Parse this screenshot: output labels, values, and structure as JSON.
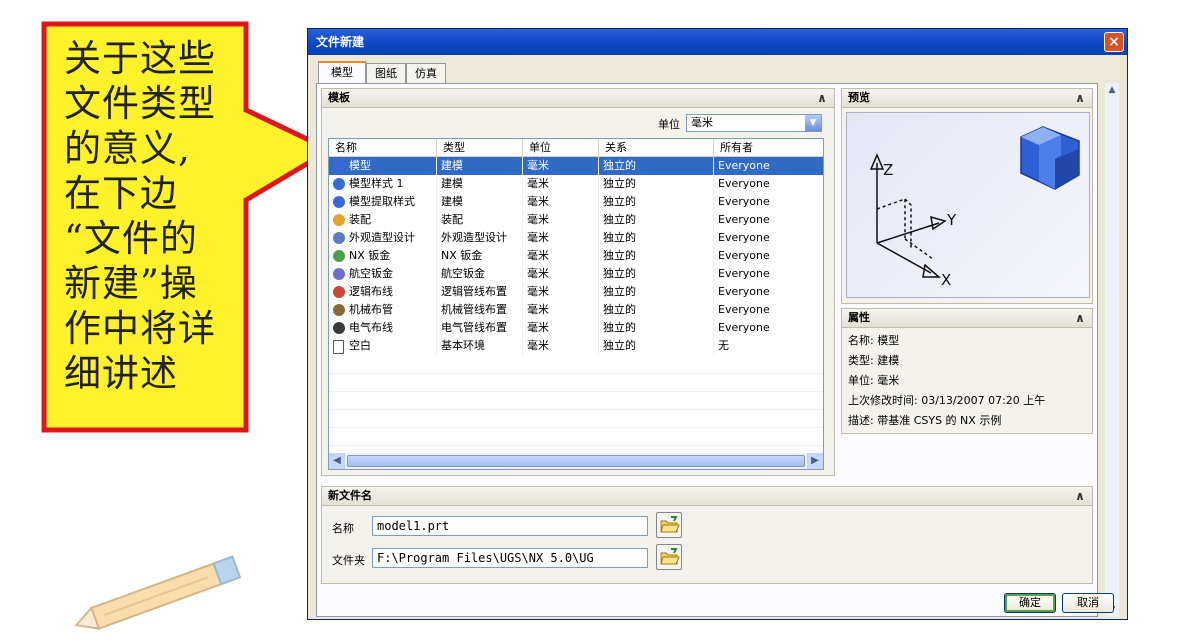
{
  "callout": {
    "lines": [
      "关于这些",
      "文件类型",
      "的意义,",
      "在下边",
      "“文件的",
      "新建”操",
      "作中将详",
      "细讲述"
    ]
  },
  "dialog": {
    "title": "文件新建",
    "close_symbol": "×",
    "tabs": [
      {
        "label": "模型"
      },
      {
        "label": "图纸"
      },
      {
        "label": "仿真"
      }
    ],
    "templates_section": {
      "title": "模板",
      "collapse_symbol": "∧",
      "unit_label": "单位",
      "unit_value": "毫米",
      "columns": [
        "名称",
        "类型",
        "单位",
        "关系",
        "所有者"
      ],
      "rows": [
        {
          "name": "模型",
          "type": "建模",
          "unit": "毫米",
          "relation": "独立的",
          "owner": "Everyone",
          "selected": true
        },
        {
          "name": "模型样式 1",
          "type": "建模",
          "unit": "毫米",
          "relation": "独立的",
          "owner": "Everyone",
          "selected": false
        },
        {
          "name": "模型提取样式",
          "type": "建模",
          "unit": "毫米",
          "relation": "独立的",
          "owner": "Everyone",
          "selected": false
        },
        {
          "name": "装配",
          "type": "装配",
          "unit": "毫米",
          "relation": "独立的",
          "owner": "Everyone",
          "selected": false
        },
        {
          "name": "外观造型设计",
          "type": "外观造型设计",
          "unit": "毫米",
          "relation": "独立的",
          "owner": "Everyone",
          "selected": false
        },
        {
          "name": "NX 钣金",
          "type": "NX 钣金",
          "unit": "毫米",
          "relation": "独立的",
          "owner": "Everyone",
          "selected": false
        },
        {
          "name": "航空钣金",
          "type": "航空钣金",
          "unit": "毫米",
          "relation": "独立的",
          "owner": "Everyone",
          "selected": false
        },
        {
          "name": "逻辑布线",
          "type": "逻辑管线布置",
          "unit": "毫米",
          "relation": "独立的",
          "owner": "Everyone",
          "selected": false
        },
        {
          "name": "机械布管",
          "type": "机械管线布置",
          "unit": "毫米",
          "relation": "独立的",
          "owner": "Everyone",
          "selected": false
        },
        {
          "name": "电气布线",
          "type": "电气管线布置",
          "unit": "毫米",
          "relation": "独立的",
          "owner": "Everyone",
          "selected": false
        },
        {
          "name": "空白",
          "type": "基本环境",
          "unit": "毫米",
          "relation": "独立的",
          "owner": "无",
          "selected": false
        }
      ]
    },
    "preview_section": {
      "title": "预览",
      "collapse_symbol": "∧",
      "axes": {
        "z": "Z",
        "y": "Y",
        "x": "X"
      }
    },
    "properties_section": {
      "title": "属性",
      "collapse_symbol": "∧",
      "lines": [
        "名称:  模型",
        "类型:  建模",
        "单位:  毫米",
        "上次修改时间:  03/13/2007 07:20 上午",
        "描述:  带基准 CSYS 的 NX 示例"
      ]
    },
    "new_filename_section": {
      "title": "新文件名",
      "collapse_symbol": "∧",
      "name_label": "名称",
      "name_value": "model1.prt",
      "folder_label": "文件夹",
      "folder_value": "F:\\Program Files\\UGS\\NX 5.0\\UG"
    },
    "buttons": {
      "ok": "确定",
      "cancel": "取消"
    }
  },
  "colors": {
    "callout_fill": "#fff22a",
    "callout_border": "#e0141b",
    "title_bar": "#0a47c8",
    "selection": "#316ac5"
  }
}
